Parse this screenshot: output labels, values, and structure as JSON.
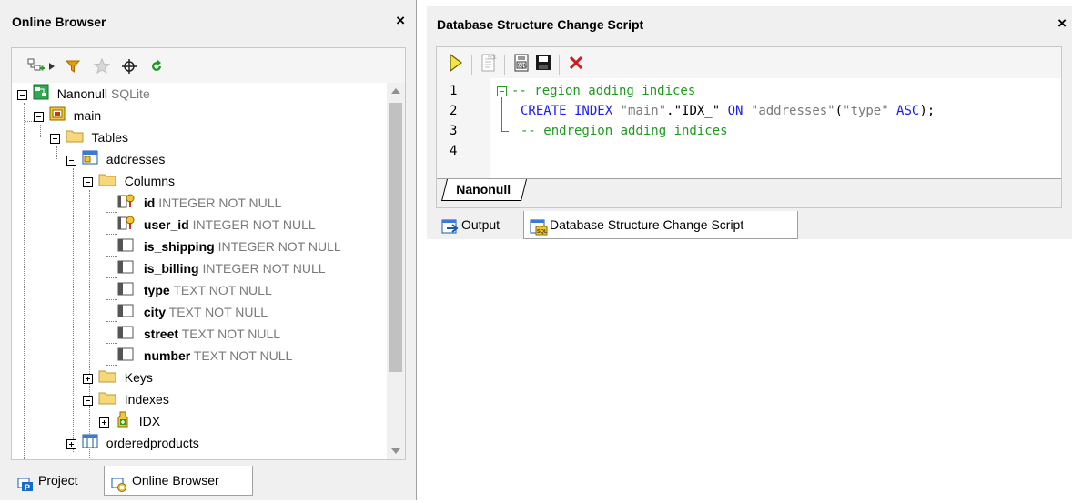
{
  "left_panel": {
    "title": "Online Browser",
    "close": "×",
    "tree": {
      "root": {
        "name": "Nanonull",
        "type": "SQLite"
      },
      "schema": "main",
      "tables_folder": "Tables",
      "table": "addresses",
      "columns_folder": "Columns",
      "columns": [
        {
          "name": "id",
          "type": "INTEGER NOT NULL",
          "icon": "key-column-icon"
        },
        {
          "name": "user_id",
          "type": "INTEGER NOT NULL",
          "icon": "key-column-icon"
        },
        {
          "name": "is_shipping",
          "type": "INTEGER NOT NULL",
          "icon": "column-icon"
        },
        {
          "name": "is_billing",
          "type": "INTEGER NOT NULL",
          "icon": "column-icon"
        },
        {
          "name": "type",
          "type": "TEXT NOT NULL",
          "icon": "column-icon"
        },
        {
          "name": "city",
          "type": "TEXT NOT NULL",
          "icon": "column-icon"
        },
        {
          "name": "street",
          "type": "TEXT NOT NULL",
          "icon": "column-icon"
        },
        {
          "name": "number",
          "type": "TEXT NOT NULL",
          "icon": "column-icon"
        }
      ],
      "keys_folder": "Keys",
      "indexes_folder": "Indexes",
      "index": "IDX_",
      "next_table": "orderedproducts"
    },
    "bottom_tabs": [
      {
        "label": "Project"
      },
      {
        "label": "Online Browser"
      }
    ]
  },
  "right_panel": {
    "title": "Database Structure Change Script",
    "close": "×",
    "code": {
      "line_numbers": [
        "1",
        "2",
        "3",
        "4"
      ],
      "line1": "-- region adding indices",
      "line2": {
        "kw1": "CREATE INDEX ",
        "s1": "\"main\"",
        "dot": ".",
        "s2": "\"IDX_\"",
        "kw2": " ON ",
        "s3": "\"addresses\"",
        "p1": "(",
        "s4": "\"type\"",
        "kw3": " ASC",
        "p2": ");"
      },
      "line3": "-- endregion adding indices"
    },
    "editor_tab": "Nanonull",
    "bottom_tabs": [
      {
        "label": "Output"
      },
      {
        "label": "Database Structure Change Script"
      }
    ]
  },
  "colors": {
    "comment": "#1f9a1f",
    "keyword": "#1a1aff",
    "string": "#7a7a7a"
  }
}
